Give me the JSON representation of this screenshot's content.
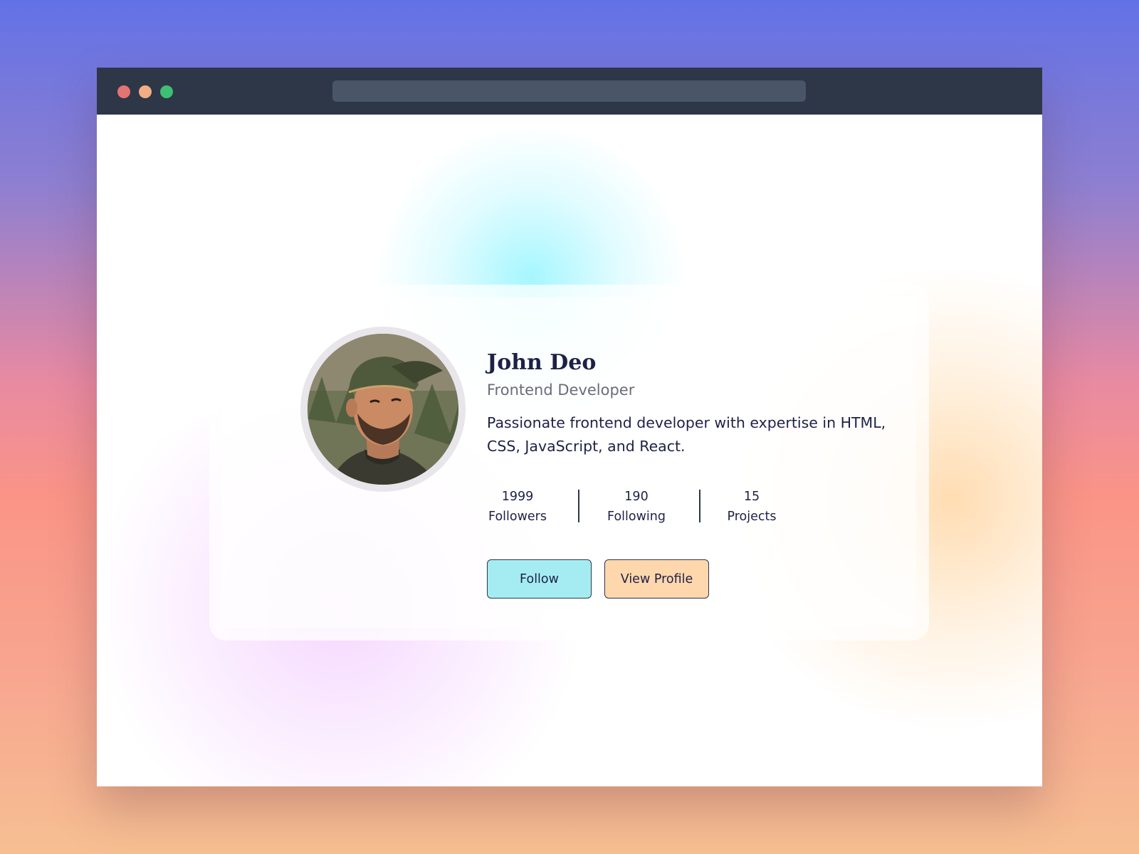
{
  "browser": {
    "window_controls": [
      "close",
      "minimize",
      "maximize"
    ],
    "address_bar_text": ""
  },
  "profile": {
    "name": "John Deo",
    "role": "Frontend Developer",
    "bio": "Passionate frontend developer with expertise in HTML, CSS, JavaScript, and React.",
    "stats": [
      {
        "value": "1999",
        "label": "Followers"
      },
      {
        "value": "190",
        "label": "Following"
      },
      {
        "value": "15",
        "label": "Projects"
      }
    ],
    "buttons": {
      "follow_label": "Follow",
      "view_profile_label": "View Profile"
    }
  },
  "colors": {
    "titlebar": "#2d3748",
    "address_bar": "#4a5568",
    "close_dot": "#e57373",
    "minimize_dot": "#f3ad85",
    "maximize_dot": "#3fbf74",
    "follow_button": "#a4ecf2",
    "view_profile_button": "#fed7ad",
    "text_primary": "#1e2146",
    "text_secondary": "#6b6b7b"
  },
  "icons": {
    "avatar": "avatar-photo"
  }
}
